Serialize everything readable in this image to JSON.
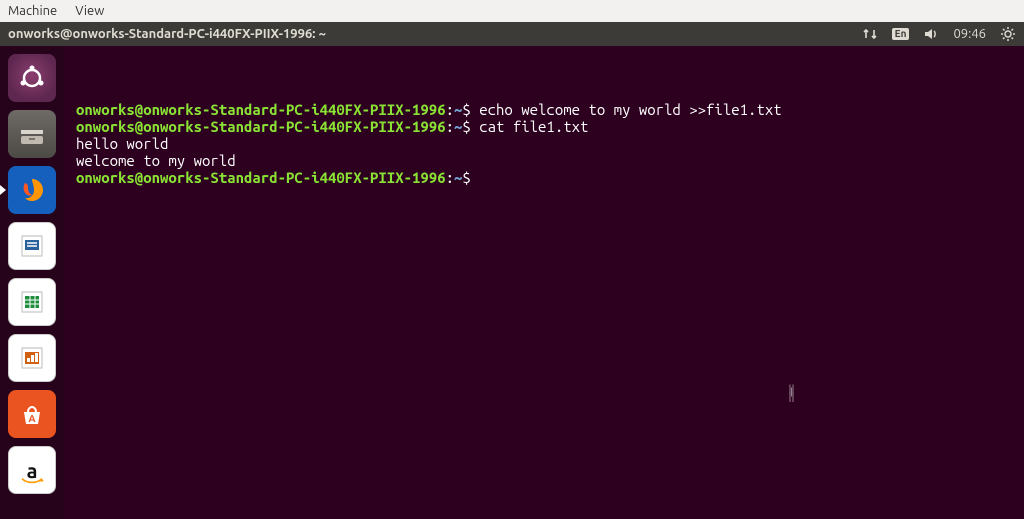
{
  "vm_menu": {
    "machine": "Machine",
    "view": "View"
  },
  "panel": {
    "title": "onworks@onworks-Standard-PC-i440FX-PIIX-1996: ~",
    "lang": "En",
    "time": "09:46"
  },
  "launcher": {
    "items": [
      {
        "name": "ubuntu-dash",
        "kind": "ubuntu"
      },
      {
        "name": "files-app",
        "kind": "files"
      },
      {
        "name": "firefox-app",
        "kind": "firefox",
        "has_pip": true
      },
      {
        "name": "libreoffice-writer",
        "kind": "writer"
      },
      {
        "name": "libreoffice-calc",
        "kind": "calc"
      },
      {
        "name": "libreoffice-impress",
        "kind": "impress"
      },
      {
        "name": "ubuntu-software",
        "kind": "soft"
      },
      {
        "name": "amazon-app",
        "kind": "amazon",
        "glyph": "a"
      }
    ]
  },
  "terminal": {
    "prompt_user": "onworks@onworks-Standard-PC-i440FX-PIIX-1996",
    "prompt_sep": ":",
    "prompt_path": "~",
    "prompt_symbol": "$",
    "lines": [
      {
        "t": "prompt",
        "cmd": "echo welcome to my world >>file1.txt"
      },
      {
        "t": "prompt",
        "cmd": "cat file1.txt"
      },
      {
        "t": "out",
        "text": "hello world"
      },
      {
        "t": "out",
        "text": "welcome to my world"
      },
      {
        "t": "prompt",
        "cmd": ""
      }
    ]
  }
}
